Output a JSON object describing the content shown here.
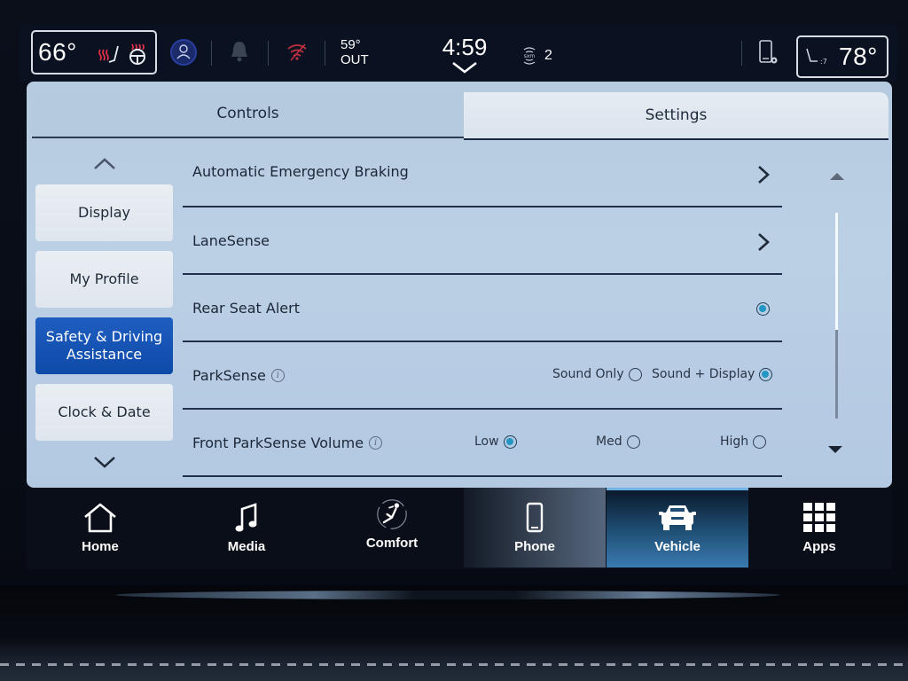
{
  "status_bar": {
    "driver_temp": "66°",
    "passenger_temp": "78°",
    "outside_temp": "59°",
    "outside_label": "OUT",
    "time": "4:59",
    "siriusxm_label": "SiriusXM",
    "siriusxm_channel": "2"
  },
  "tabs": [
    {
      "label": "Controls",
      "active": false
    },
    {
      "label": "Settings",
      "active": true
    }
  ],
  "side_nav": {
    "items": [
      {
        "label": "Display",
        "active": false
      },
      {
        "label": "My Profile",
        "active": false
      },
      {
        "label": "Safety & Driving Assistance",
        "active": true
      },
      {
        "label": "Clock & Date",
        "active": false
      }
    ]
  },
  "settings": {
    "rows": [
      {
        "label": "Automatic Emergency Braking",
        "control": "submenu"
      },
      {
        "label": "LaneSense",
        "control": "submenu"
      },
      {
        "label": "Rear Seat Alert",
        "control": "checkbox",
        "checked": true
      },
      {
        "label": "ParkSense",
        "info": true,
        "control": "radio",
        "options": [
          "Sound Only",
          "Sound + Display"
        ],
        "selected": "Sound + Display"
      },
      {
        "label": "Front ParkSense Volume",
        "info": true,
        "control": "radio",
        "options": [
          "Low",
          "Med",
          "High"
        ],
        "selected": "Low"
      }
    ],
    "scroll_position": 0.57
  },
  "bottom_nav": {
    "items": [
      {
        "label": "Home",
        "icon": "home-icon",
        "active": false
      },
      {
        "label": "Media",
        "icon": "music-note-icon",
        "active": false
      },
      {
        "label": "Comfort",
        "icon": "seat-comfort-icon",
        "active": false
      },
      {
        "label": "Phone",
        "icon": "phone-icon",
        "active": false
      },
      {
        "label": "Vehicle",
        "icon": "car-icon",
        "active": true
      },
      {
        "label": "Apps",
        "icon": "apps-grid-icon",
        "active": false
      }
    ]
  },
  "colors": {
    "accent_blue": "#0d4aa8",
    "radio_selected": "#2496c4",
    "heat_indicator": "#e0304a"
  }
}
